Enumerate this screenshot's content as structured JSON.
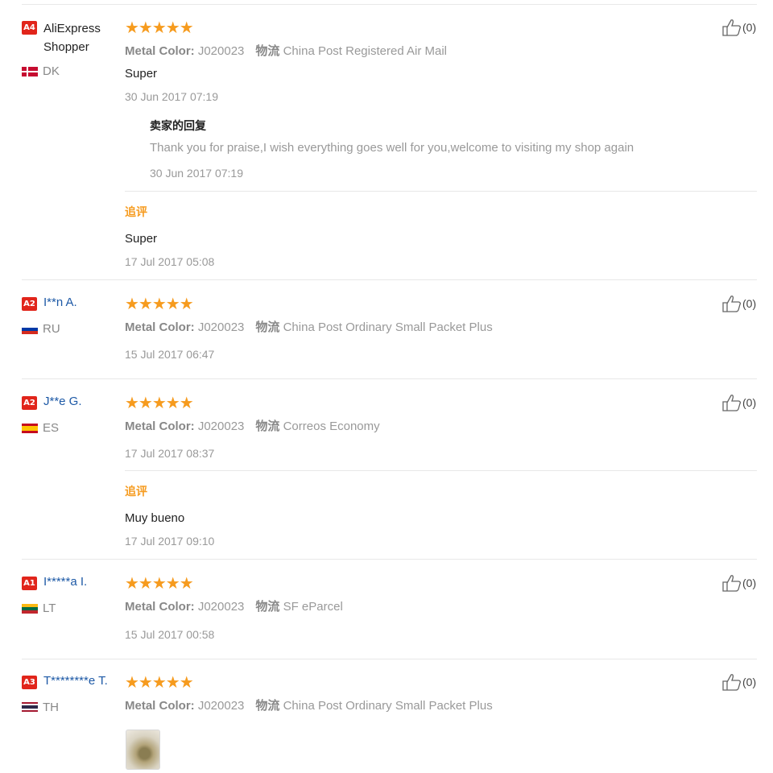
{
  "colors": {
    "star": "#f69b1e",
    "badge": "#e1251b",
    "link": "#1d59a6",
    "additional": "#f69b1e"
  },
  "labels": {
    "metal_color": "Metal Color:",
    "logistics": "物流",
    "seller_reply": "卖家的回复",
    "additional_feedback": "追评",
    "stars": "★★★★★"
  },
  "icons": {
    "helpful": "thumbs-up-icon"
  },
  "reviews": [
    {
      "level": "A4",
      "name": "AliExpress Shopper",
      "country": "DK",
      "metal_color": "J020023",
      "shipping": "China Post Registered Air Mail",
      "text": "Super",
      "date": "30 Jun 2017 07:19",
      "reply": {
        "text": "Thank you for praise,I wish everything goes well for you,welcome to visiting my shop again",
        "date": "30 Jun 2017 07:19"
      },
      "additional": {
        "text": "Super",
        "date": "17 Jul 2017 05:08"
      },
      "helpful": "(0)"
    },
    {
      "level": "A2",
      "name": "I**n A.",
      "country": "RU",
      "metal_color": "J020023",
      "shipping": "China Post Ordinary Small Packet Plus",
      "date": "15 Jul 2017 06:47",
      "helpful": "(0)"
    },
    {
      "level": "A2",
      "name": "J**e G.",
      "country": "ES",
      "metal_color": "J020023",
      "shipping": "Correos Economy",
      "date": "17 Jul 2017 08:37",
      "additional": {
        "text": "Muy bueno",
        "date": "17 Jul 2017 09:10"
      },
      "helpful": "(0)"
    },
    {
      "level": "A1",
      "name": "I*****a I.",
      "country": "LT",
      "metal_color": "J020023",
      "shipping": "SF eParcel",
      "date": "15 Jul 2017 00:58",
      "helpful": "(0)"
    },
    {
      "level": "A3",
      "name": "T********e T.",
      "country": "TH",
      "metal_color": "J020023",
      "shipping": "China Post Ordinary Small Packet Plus",
      "helpful": "(0)"
    }
  ]
}
